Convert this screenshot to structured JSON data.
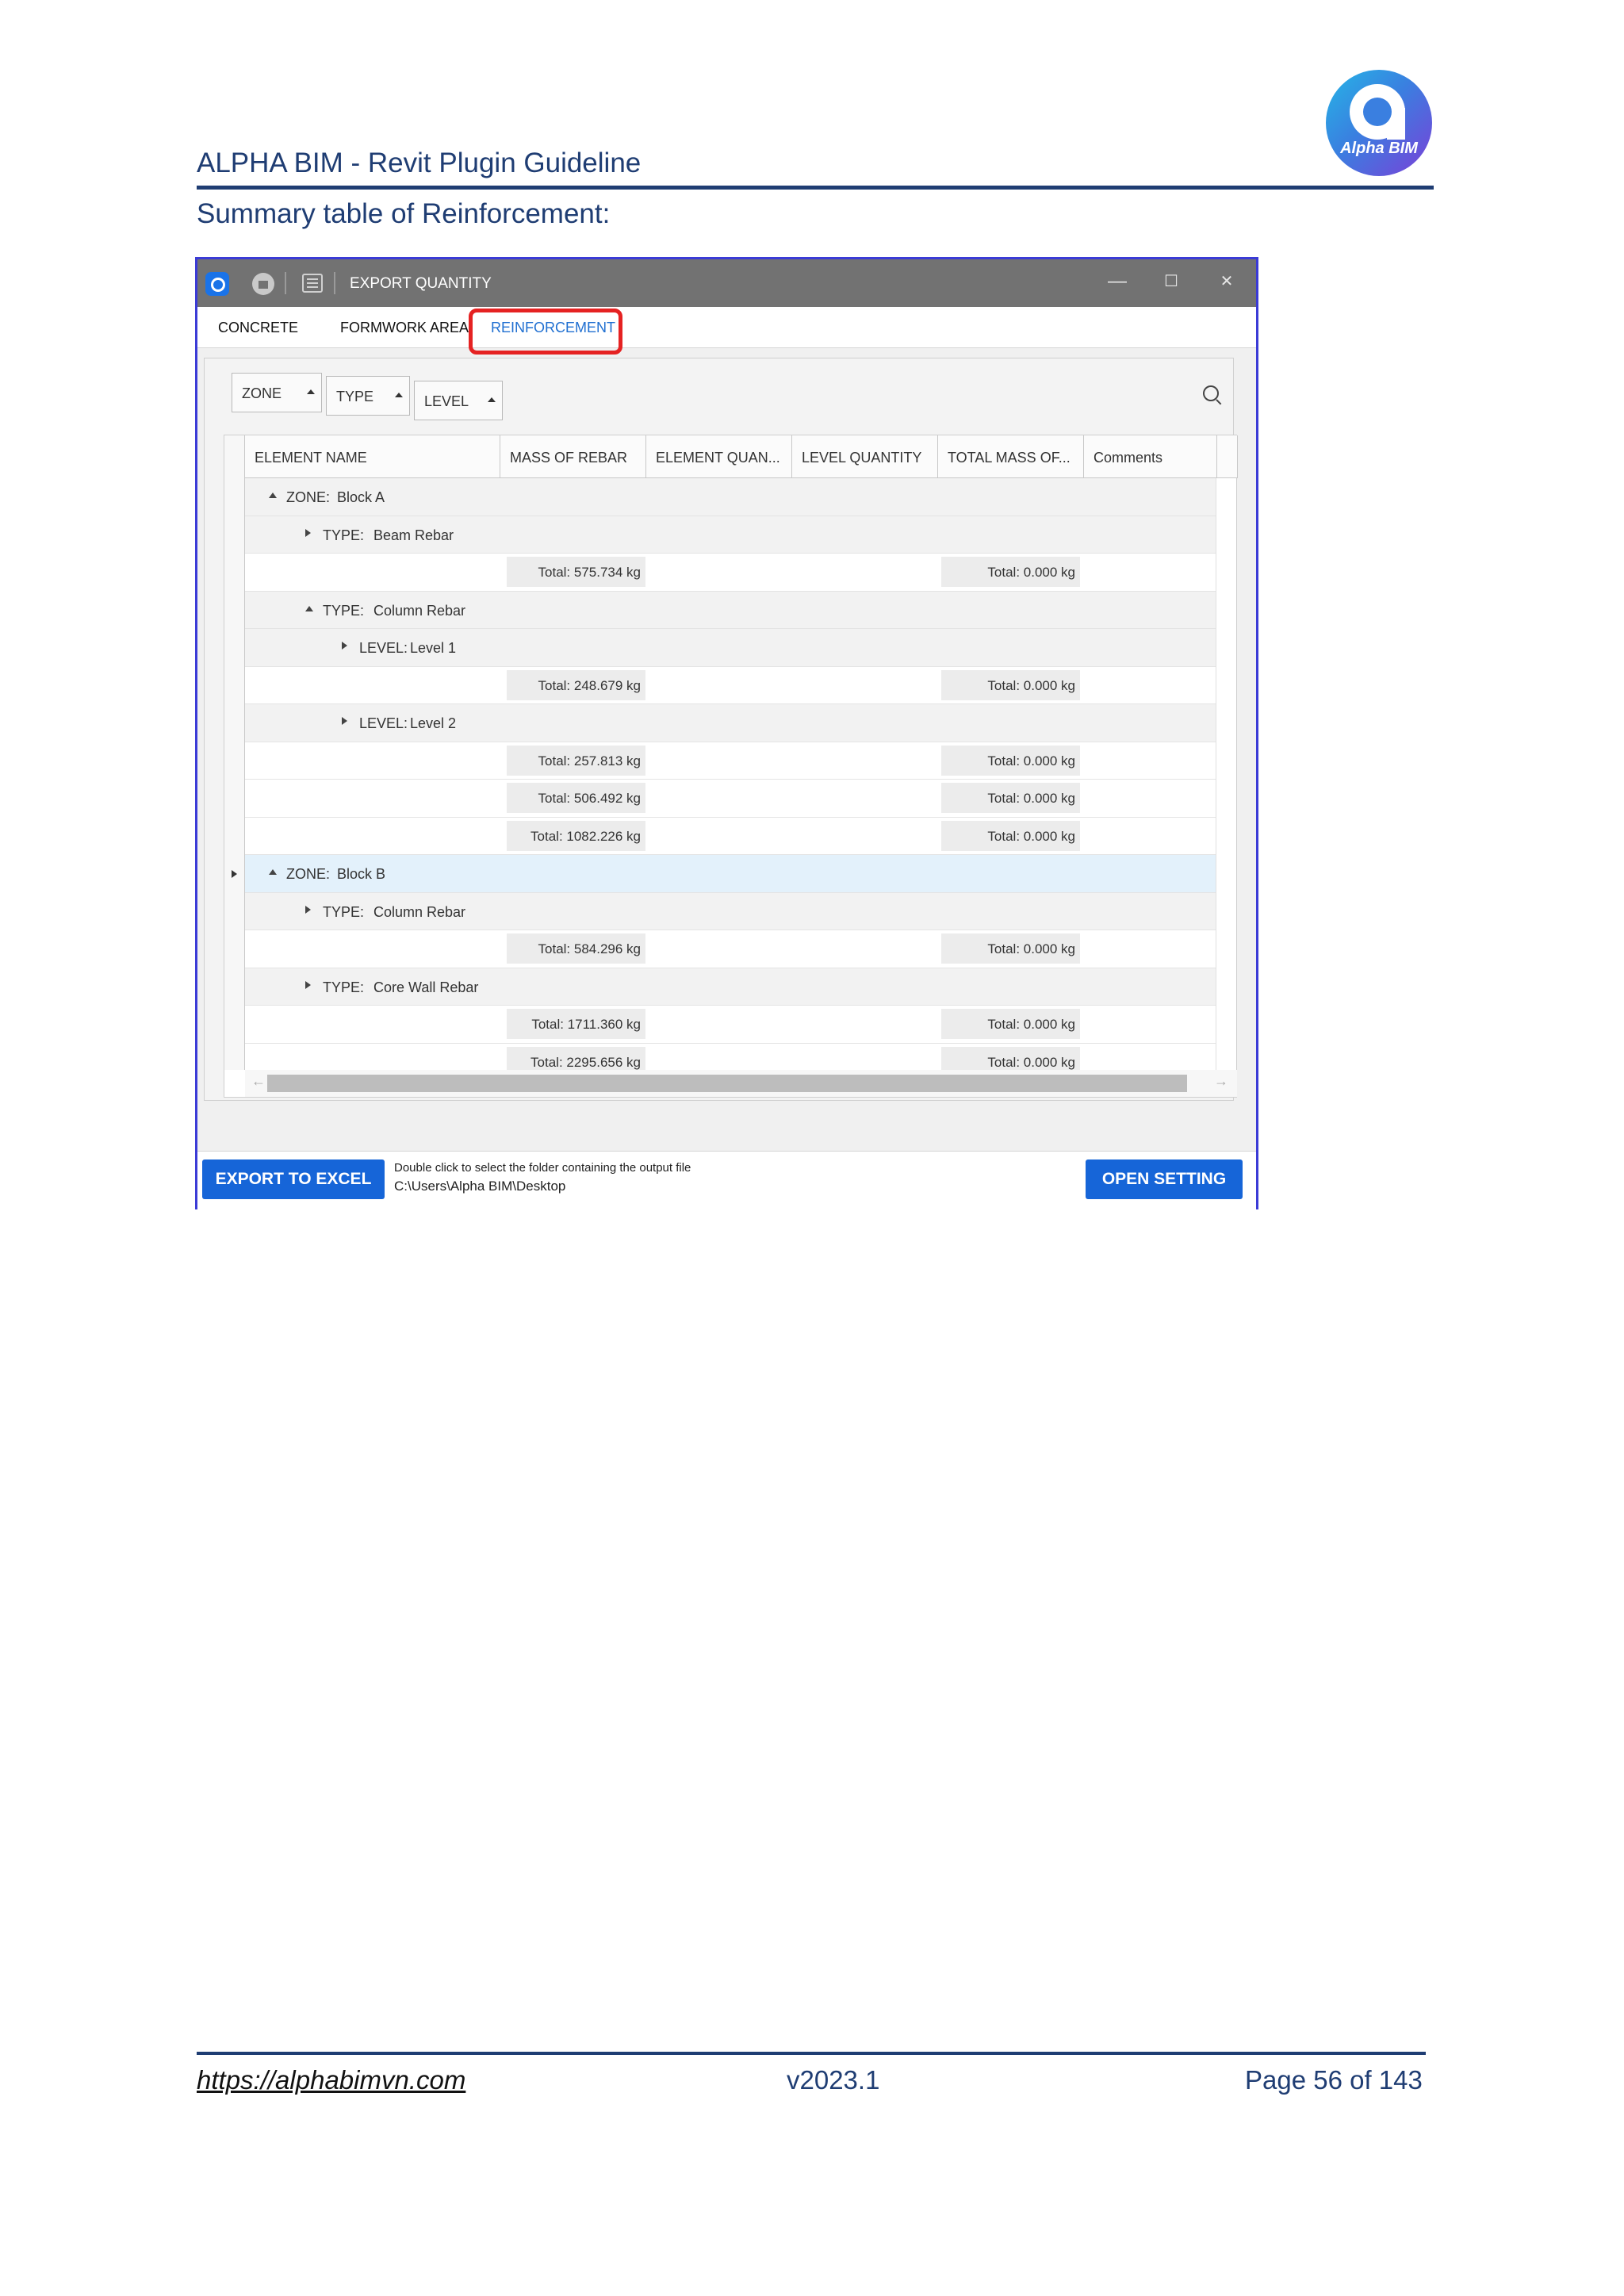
{
  "document": {
    "header_title": "ALPHA BIM - Revit Plugin Guideline",
    "logo_text": "Alpha BIM",
    "subtitle": "Summary table of Reinforcement:",
    "footer_link": "https://alphabimvn.com",
    "footer_version": "v2023.1",
    "footer_page": "Page 56 of 143"
  },
  "window": {
    "title": "EXPORT QUANTITY",
    "controls": {
      "minimize": "—",
      "maximize": "☐",
      "close": "✕"
    }
  },
  "tabs": [
    {
      "label": "CONCRETE"
    },
    {
      "label": "FORMWORK AREA"
    },
    {
      "label": "REINFORCEMENT"
    }
  ],
  "active_tab": "REINFORCEMENT",
  "group_chips": [
    {
      "label": "ZONE"
    },
    {
      "label": "TYPE"
    },
    {
      "label": "LEVEL"
    }
  ],
  "columns": [
    {
      "label": "ELEMENT NAME"
    },
    {
      "label": "MASS OF REBAR"
    },
    {
      "label": "ELEMENT QUAN..."
    },
    {
      "label": "LEVEL QUANTITY"
    },
    {
      "label": "TOTAL MASS OF..."
    },
    {
      "label": "Comments"
    }
  ],
  "rows": [
    {
      "kind": "group",
      "depth": 0,
      "expanded": true,
      "key": "ZONE:",
      "value": "Block A"
    },
    {
      "kind": "group",
      "depth": 1,
      "expanded": false,
      "key": "TYPE:",
      "value": "Beam Rebar"
    },
    {
      "kind": "summary",
      "mass": "Total: 575.734 kg",
      "total": "Total: 0.000 kg"
    },
    {
      "kind": "group",
      "depth": 1,
      "expanded": true,
      "key": "TYPE:",
      "value": "Column Rebar"
    },
    {
      "kind": "group",
      "depth": 2,
      "expanded": false,
      "key": "LEVEL:",
      "value": "Level 1"
    },
    {
      "kind": "summary",
      "mass": "Total: 248.679 kg",
      "total": "Total: 0.000 kg"
    },
    {
      "kind": "group",
      "depth": 2,
      "expanded": false,
      "key": "LEVEL:",
      "value": "Level 2"
    },
    {
      "kind": "summary",
      "mass": "Total: 257.813 kg",
      "total": "Total: 0.000 kg"
    },
    {
      "kind": "summary",
      "mass": "Total: 506.492 kg",
      "total": "Total: 0.000 kg"
    },
    {
      "kind": "summary",
      "mass": "Total: 1082.226 kg",
      "total": "Total: 0.000 kg"
    },
    {
      "kind": "group",
      "depth": 0,
      "expanded": true,
      "selected": true,
      "key": "ZONE:",
      "value": "Block B"
    },
    {
      "kind": "group",
      "depth": 1,
      "expanded": false,
      "key": "TYPE:",
      "value": "Column Rebar"
    },
    {
      "kind": "summary",
      "mass": "Total: 584.296 kg",
      "total": "Total: 0.000 kg"
    },
    {
      "kind": "group",
      "depth": 1,
      "expanded": false,
      "key": "TYPE:",
      "value": "Core Wall Rebar"
    },
    {
      "kind": "summary",
      "mass": "Total: 1711.360 kg",
      "total": "Total: 0.000 kg"
    },
    {
      "kind": "summary",
      "mass": "Total: 2295.656 kg",
      "total": "Total: 0.000 kg"
    }
  ],
  "footer": {
    "export_button": "EXPORT TO EXCEL",
    "hint": "Double click to select the folder containing the output file",
    "path": "C:\\Users\\Alpha BIM\\Desktop",
    "settings_button": "OPEN SETTING"
  },
  "colors": {
    "accent_blue": "#1665d8",
    "tab_active": "#1f6fd1",
    "highlight_red": "#e52222",
    "doc_blue": "#1f3d73",
    "titlebar_gray": "#727272",
    "selected_row": "#e3f1fb"
  }
}
